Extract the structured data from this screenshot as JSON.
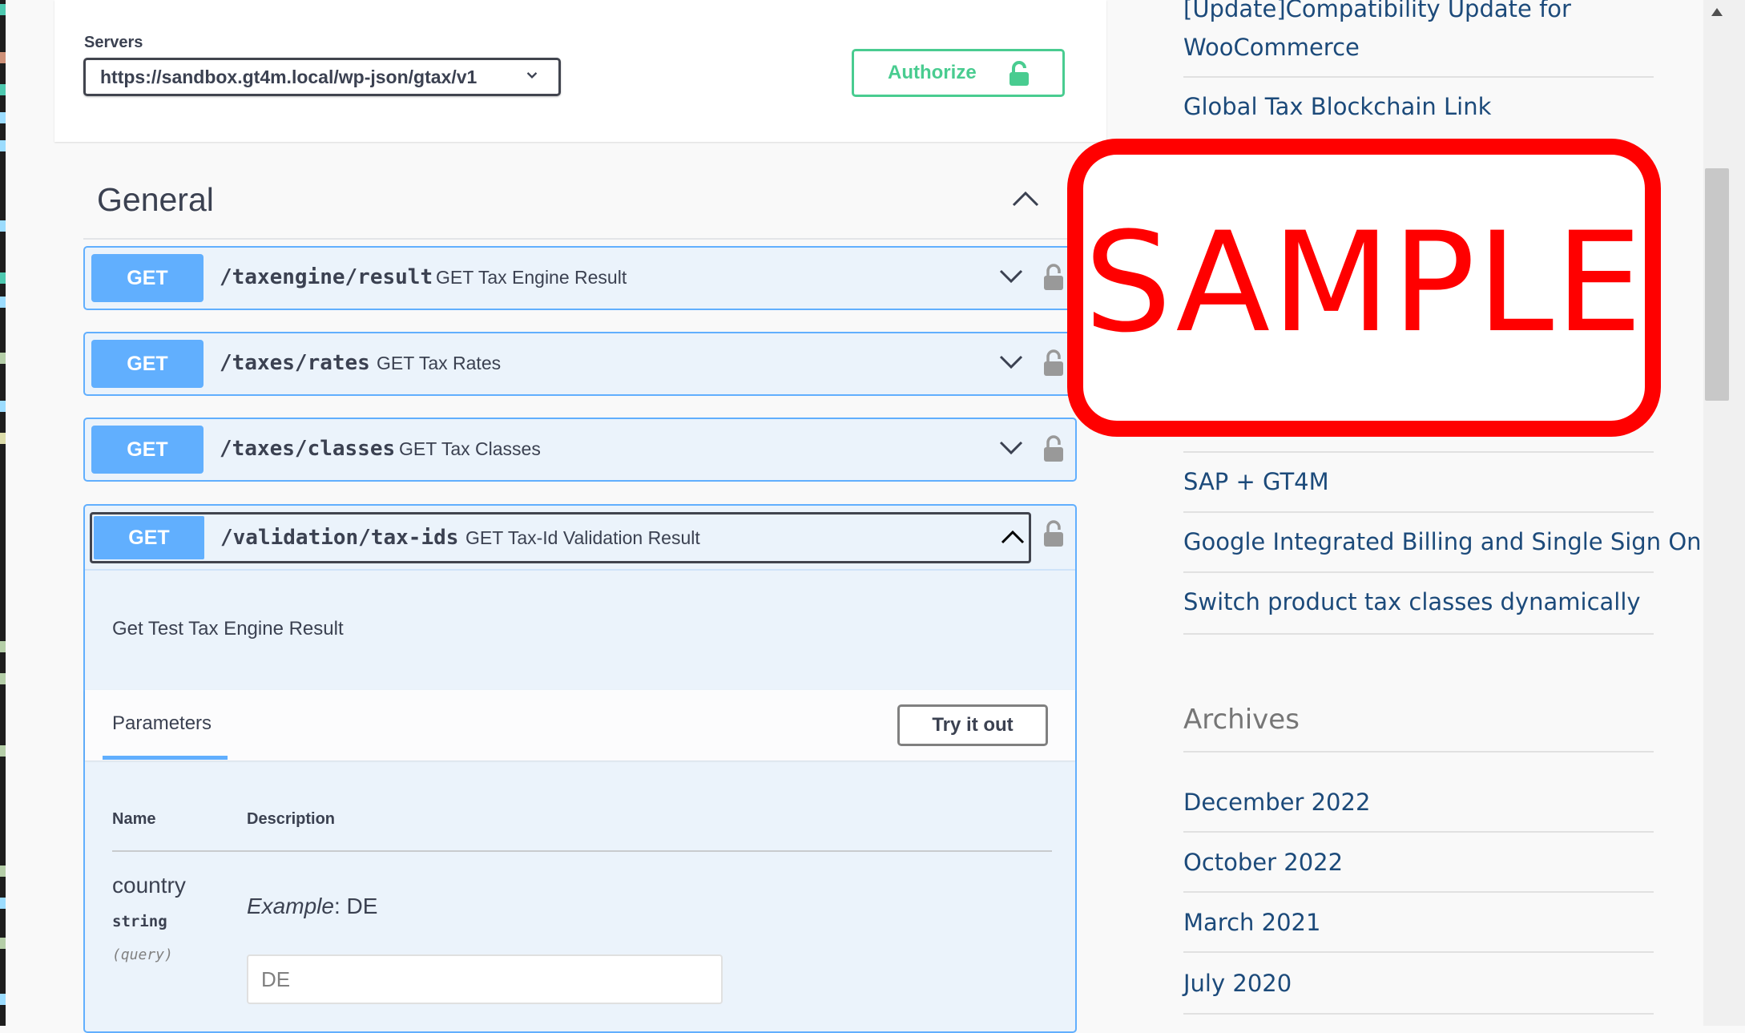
{
  "servers": {
    "label": "Servers",
    "selected": "https://sandbox.gt4m.local/wp-json/gtax/v1"
  },
  "authorize": {
    "label": "Authorize"
  },
  "section": {
    "title": "General"
  },
  "operations": [
    {
      "method": "GET",
      "path": "/taxengine/result",
      "summary": "GET Tax Engine Result"
    },
    {
      "method": "GET",
      "path": "/taxes/rates",
      "summary": "GET Tax Rates"
    },
    {
      "method": "GET",
      "path": "/taxes/classes",
      "summary": "GET Tax Classes"
    }
  ],
  "open_operation": {
    "method": "GET",
    "path": "/validation/tax-ids",
    "summary": "GET Tax-Id Validation Result",
    "description": "Get Test Tax Engine Result",
    "parameters_tab": "Parameters",
    "try_it_out": "Try it out",
    "col_name": "Name",
    "col_description": "Description",
    "param": {
      "name": "country",
      "type": "string",
      "in": "(query)",
      "example_label": "Example",
      "example_value": ": DE",
      "value": "DE"
    }
  },
  "sidebar": {
    "recent_posts": [
      "[Update]Compatibility Update for",
      "WooCommerce",
      "Global Tax Blockchain Link",
      "SAP + GT4M",
      "Google Integrated Billing and Single Sign On",
      "Switch product tax classes dynamically"
    ],
    "archives_title": "Archives",
    "archives": [
      "December 2022",
      "October 2022",
      "March 2021",
      "July 2020"
    ]
  },
  "stamp": {
    "text": "SAMPLE"
  },
  "colors": {
    "get": "#61affe",
    "get_bg": "#ebf3fb",
    "authorize": "#49cc90",
    "link": "#1c4a7a",
    "stamp": "#ff0000"
  }
}
